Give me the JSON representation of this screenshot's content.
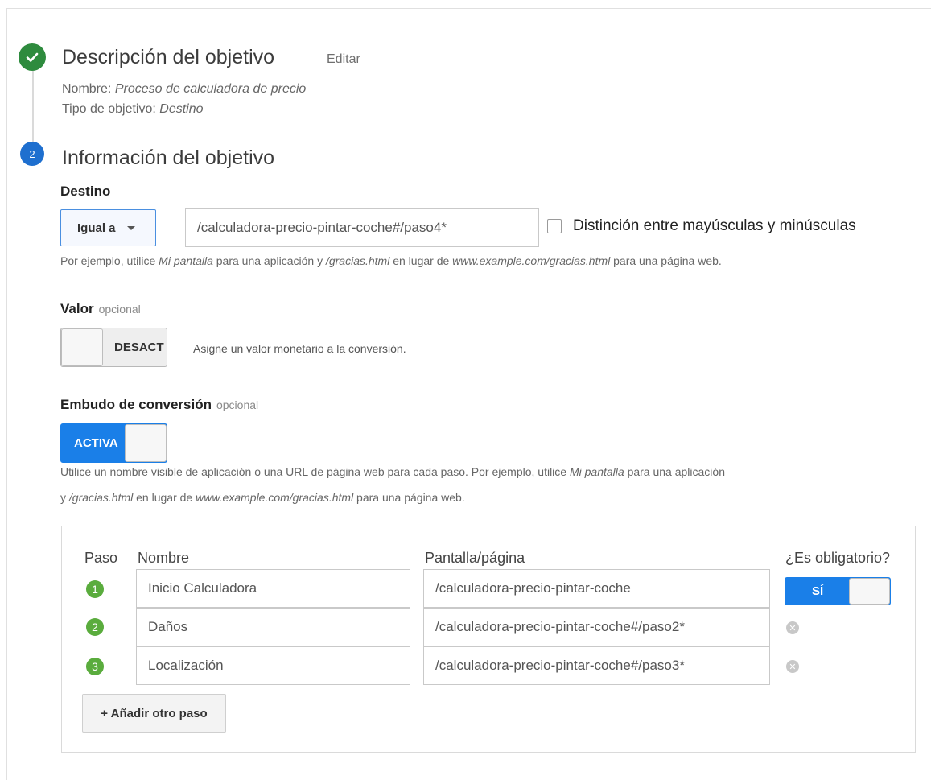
{
  "step1": {
    "title": "Descripción del objetivo",
    "edit_label": "Editar",
    "name_label": "Nombre:",
    "name_value": "Proceso de calculadora de precio",
    "type_label": "Tipo de objetivo:",
    "type_value": "Destino"
  },
  "step2": {
    "number": "2",
    "title": "Información del objetivo"
  },
  "destination": {
    "label": "Destino",
    "match_type": "Igual a",
    "value": "/calculadora-precio-pintar-coche#/paso4*",
    "case_sensitive_label": "Distinción entre mayúsculas y minúsculas",
    "case_sensitive_checked": false,
    "hint_prefix": "Por ejemplo, utilice",
    "hint_app": "Mi pantalla",
    "hint_mid1": "para una aplicación y",
    "hint_page": "/gracias.html",
    "hint_mid2": "en lugar de",
    "hint_url": "www.example.com/gracias.html",
    "hint_suffix": "para una página web."
  },
  "value_section": {
    "label": "Valor",
    "optional": "opcional",
    "toggle_label": "DESACT",
    "toggle_on": false,
    "description": "Asigne un valor monetario a la conversión."
  },
  "funnel": {
    "label": "Embudo de conversión",
    "optional": "opcional",
    "toggle_label": "ACTIVA",
    "toggle_on": true,
    "hint_line1_prefix": "Utilice un nombre visible de aplicación o una URL de página web para cada paso. Por ejemplo, utilice",
    "hint_line1_app": "Mi pantalla",
    "hint_line1_suffix": "para una aplicación",
    "hint_line2_prefix": "y",
    "hint_line2_page": "/gracias.html",
    "hint_line2_mid": "en lugar de",
    "hint_line2_url": "www.example.com/gracias.html",
    "hint_line2_suffix": "para una página web.",
    "columns": {
      "step": "Paso",
      "name": "Nombre",
      "screen": "Pantalla/página",
      "required": "¿Es obligatorio?"
    },
    "rows": [
      {
        "number": "1",
        "name": "Inicio Calculadora",
        "screen": "/calculadora-precio-pintar-coche"
      },
      {
        "number": "2",
        "name": "Daños",
        "screen": "/calculadora-precio-pintar-coche#/paso2*"
      },
      {
        "number": "3",
        "name": "Localización",
        "screen": "/calculadora-precio-pintar-coche#/paso3*"
      }
    ],
    "required_toggle_label": "SÍ",
    "add_step_label": "+ Añadir otro paso"
  }
}
